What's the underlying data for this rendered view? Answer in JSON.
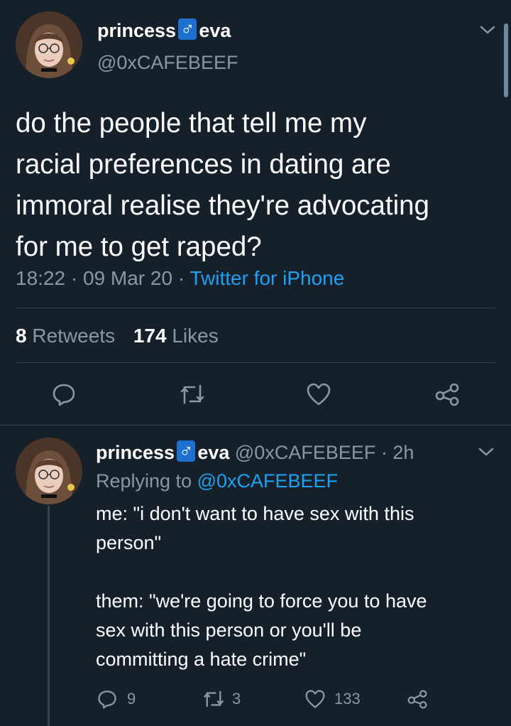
{
  "main_tweet": {
    "display_name_prefix": "princess",
    "display_name_symbol": "♂",
    "display_name_suffix": "eva",
    "handle": "@0xCAFEBEEF",
    "text_lines": [
      "do the people that tell me my",
      "racial preferences in dating are",
      "immoral realise they're advocating",
      "for me to get raped?"
    ],
    "time": "18:22",
    "date": "09 Mar 20",
    "separator": "·",
    "source": "Twitter for iPhone",
    "retweets_count": "8",
    "retweets_label": "Retweets",
    "likes_count": "174",
    "likes_label": "Likes"
  },
  "reply_tweet": {
    "display_name_prefix": "princess",
    "display_name_symbol": "♂",
    "display_name_suffix": "eva",
    "handle": "@0xCAFEBEEF",
    "separator": "·",
    "age": "2h",
    "replying_label": "Replying to",
    "replying_handle": "@0xCAFEBEEF",
    "paragraph1_lines": [
      "me: \"i don't want to have sex with this",
      "person\""
    ],
    "paragraph2_lines": [
      "them: \"we're going to force you to have",
      "sex with this person or you'll be",
      "committing a hate crime\""
    ],
    "reply_count": "9",
    "retweet_count": "3",
    "like_count": "133"
  },
  "colors": {
    "background": "#15202b",
    "text": "#ffffff",
    "muted": "#8899a6",
    "link": "#1da1f2",
    "divider": "#38444d",
    "symbol_box": "#1d6fd0"
  },
  "icons": [
    "chevron-down-icon",
    "reply-icon",
    "retweet-icon",
    "like-icon",
    "share-icon",
    "avatar"
  ]
}
